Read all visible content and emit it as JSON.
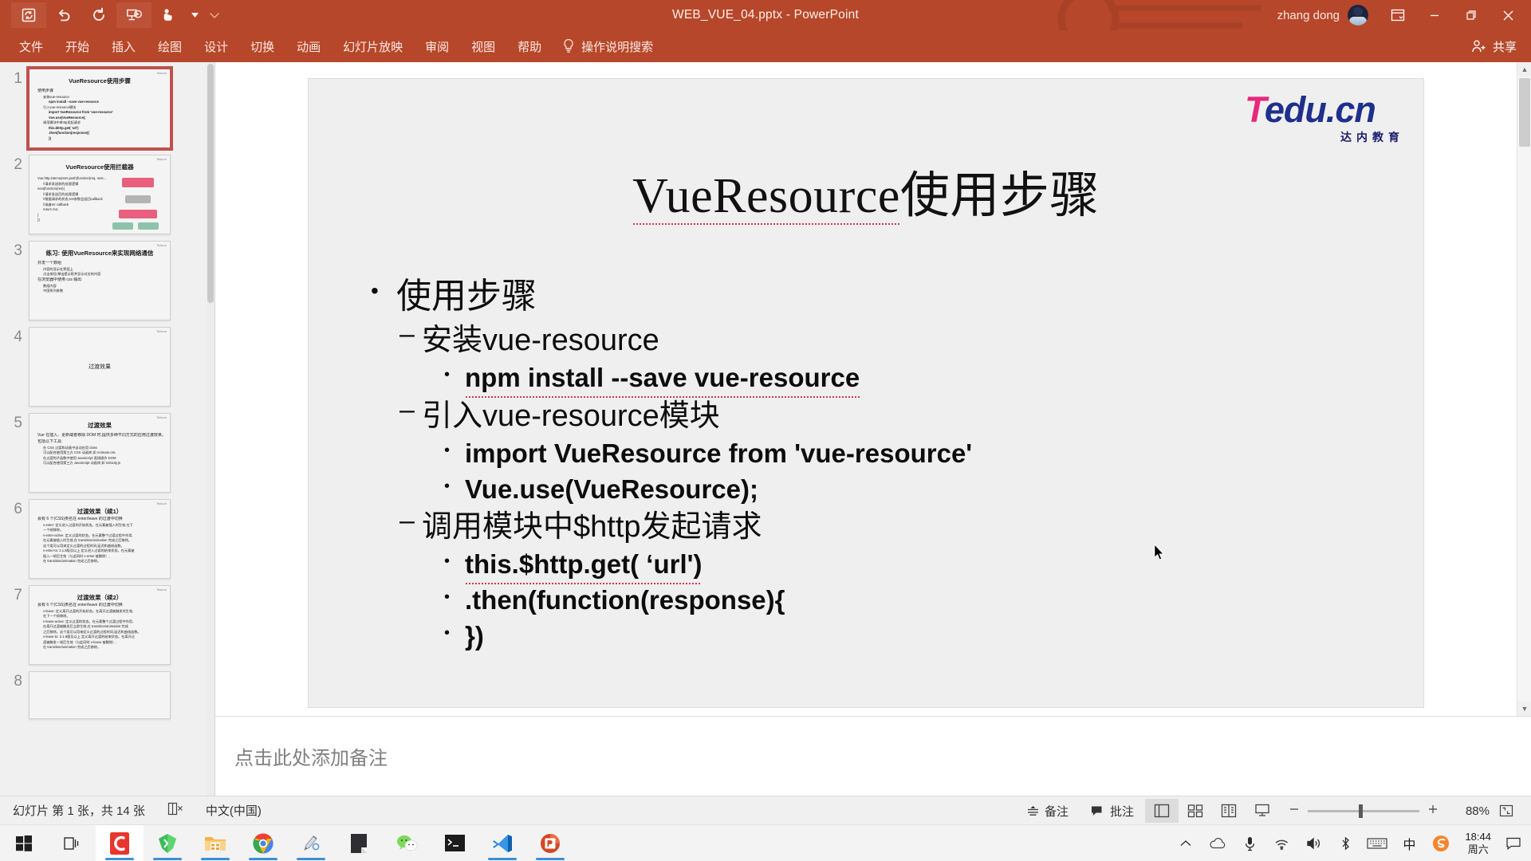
{
  "window": {
    "title": "WEB_VUE_04.pptx  -  PowerPoint",
    "account_name": "zhang dong",
    "ribbon_display_label": "ribbon-display-options",
    "minimize_label": "最小化",
    "restore_label": "还原",
    "close_label": "关闭"
  },
  "quick_access": [
    {
      "name": "autosave-icon",
      "label": "自动保存"
    },
    {
      "name": "undo-icon",
      "label": "撤消"
    },
    {
      "name": "redo-icon",
      "label": "恢复"
    },
    {
      "name": "start-from-beginning-icon",
      "label": "从头开始"
    },
    {
      "name": "touch-mode-icon",
      "label": "触摸/鼠标模式"
    },
    {
      "name": "customize-qat-icon",
      "label": "自定义快速访问工具栏"
    }
  ],
  "ribbon": {
    "tabs": [
      {
        "label": "文件",
        "active": false
      },
      {
        "label": "开始",
        "active": false
      },
      {
        "label": "插入",
        "active": false
      },
      {
        "label": "绘图",
        "active": false
      },
      {
        "label": "设计",
        "active": false
      },
      {
        "label": "切换",
        "active": false
      },
      {
        "label": "动画",
        "active": false
      },
      {
        "label": "幻灯片放映",
        "active": false
      },
      {
        "label": "审阅",
        "active": false
      },
      {
        "label": "视图",
        "active": false
      },
      {
        "label": "帮助",
        "active": false
      }
    ],
    "tell_me": "操作说明搜索",
    "share": "共享"
  },
  "thumbnails": [
    {
      "number": "1",
      "selected": true,
      "title": "VueResource使用步骤",
      "logo": "Tedu.cn",
      "lines": [
        {
          "level": 1,
          "text": "使用步骤"
        },
        {
          "level": 2,
          "text": "安装vue-resource"
        },
        {
          "level": 3,
          "text": "npm install --save vue-resource"
        },
        {
          "level": 2,
          "text": "引入vue-resource模块"
        },
        {
          "level": 3,
          "text": "import VueResource from 'vue-resource'"
        },
        {
          "level": 3,
          "text": "Vue.use(VueResource);"
        },
        {
          "level": 2,
          "text": "调用模块中$http发起请求"
        },
        {
          "level": 3,
          "text": "this.$http.get( 'url')"
        },
        {
          "level": 3,
          "text": ".then(function(response){"
        },
        {
          "level": 3,
          "text": "})"
        }
      ]
    },
    {
      "number": "2",
      "selected": false,
      "title": "VueResource使用拦截器",
      "logo": "Tedu.cn",
      "lines": [
        {
          "level": 3,
          "text": "Vue.http.interceptors.push(function(req, next..."
        },
        {
          "level": 2,
          "text": "//请求发送前的处理逻辑"
        },
        {
          "level": 3,
          "text": "next(function(res){"
        },
        {
          "level": 2,
          "text": "//请求发送后的处理逻辑"
        },
        {
          "level": 2,
          "text": "//根据请求的状态,res参数会返回callback"
        },
        {
          "level": 2,
          "text": "//或者err callback"
        },
        {
          "level": 2,
          "text": "return res;"
        },
        {
          "level": 3,
          "text": "}"
        },
        {
          "level": 3,
          "text": "})"
        }
      ]
    },
    {
      "number": "3",
      "selected": false,
      "title": "练习: 使用VueResource来实现网络通信",
      "logo": "Tedu.cn",
      "lines": [
        {
          "level": 1,
          "text": "并发一个数组"
        },
        {
          "level": 2,
          "text": "内容的显示在界面上"
        },
        {
          "level": 2,
          "text": "点击按钮,弹出提示框并显示对应的内容"
        },
        {
          "level": 1,
          "text": "在浏览器中使用 css 输出"
        },
        {
          "level": 2,
          "text": "数组内容"
        },
        {
          "level": 2,
          "text": "中国系列参数"
        }
      ]
    },
    {
      "number": "4",
      "selected": false,
      "title": "",
      "logo": "Tedu.cn",
      "center_text": "过渡效果",
      "lines": []
    },
    {
      "number": "5",
      "selected": false,
      "title": "过渡效果",
      "logo": "Tedu.cn",
      "lines": [
        {
          "level": 1,
          "text": "Vue 在插入、更新或者移除 DOM 时,提供多种不同方式的应用过渡效果。"
        },
        {
          "level": 1,
          "text": "包括以下工具:"
        },
        {
          "level": 2,
          "text": "在 CSS 过渡和动画中自动应用 class"
        },
        {
          "level": 2,
          "text": "可以配合使用第三方 CSS 动画库,如 Animate.css"
        },
        {
          "level": 2,
          "text": "在过渡钩子函数中使用 JavaScript 直接操作 DOM"
        },
        {
          "level": 2,
          "text": "可以配合使用第三方 JavaScript 动画库,如 Velocity.js"
        }
      ]
    },
    {
      "number": "6",
      "selected": false,
      "title": "过渡效果（续1）",
      "logo": "Tedu.cn",
      "lines": [
        {
          "level": 1,
          "text": "会有 6 个(CSS)类名在 enter/leave 的过渡中切换"
        },
        {
          "level": 2,
          "text": "v-enter: 定义进入过渡的开始状态。在元素被插入时生效,在下"
        },
        {
          "level": 2,
          "text": "一个帧移除。"
        },
        {
          "level": 2,
          "text": "v-enter-active: 定义过渡的状态。在元素整个过渡过程中作用,"
        },
        {
          "level": 2,
          "text": "在元素被插入时生效,在 transition/animation 完成之后移除。"
        },
        {
          "level": 2,
          "text": "这个类可以用来定义过渡的过程时间,延迟和曲线函数。"
        },
        {
          "level": 2,
          "text": "v-enter-to: 2.1.8版及以上 定义进入过渡的结束状态。在元素被"
        },
        {
          "level": 2,
          "text": "插入一帧后生效（与此同时 v-enter 被删除）,"
        },
        {
          "level": 2,
          "text": "在 transition/animation 完成之后移除。"
        }
      ]
    },
    {
      "number": "7",
      "selected": false,
      "title": "过渡效果（续2）",
      "logo": "Tedu.cn",
      "lines": [
        {
          "level": 1,
          "text": "会有 6 个(CSS)类名在 enter/leave 的过渡中切换"
        },
        {
          "level": 2,
          "text": "v-leave: 定义离开过渡的开始状态。在离开过渡被触发时生效,"
        },
        {
          "level": 2,
          "text": "在下一个帧移除。"
        },
        {
          "level": 2,
          "text": "v-leave-active: 定义过渡的状态。在元素整个过渡过程中作用,"
        },
        {
          "level": 2,
          "text": "在离开过渡被触发后立即生效,在 transition/animation 完成"
        },
        {
          "level": 2,
          "text": "之后移除。这个类可以用来定义过渡的过程时间,延迟和曲线函数。"
        },
        {
          "level": 2,
          "text": "v-leave-to: 2.1.8版及以上 定义离开过渡的结束状态。在离开过"
        },
        {
          "level": 2,
          "text": "渡被触发一帧后生效（与此同时 v-leave 被删除）,"
        },
        {
          "level": 2,
          "text": "在 transition/animation 完成之后移除。"
        }
      ]
    },
    {
      "number": "8",
      "selected": false,
      "title": "",
      "logo": "",
      "lines": []
    }
  ],
  "slide": {
    "logo_t": "T",
    "logo_rest": "edu.cn",
    "logo_sub": "达内教育",
    "title_underlined": "VueResource",
    "title_rest": "使用步骤",
    "bullets": [
      {
        "level": 1,
        "bullet": "•",
        "text": "使用步骤"
      },
      {
        "level": 2,
        "bullet": "–",
        "text": "安装vue-resource"
      },
      {
        "level": 3,
        "bullet": "•",
        "text": "npm install --save vue-resource"
      },
      {
        "level": 2,
        "bullet": "–",
        "text": "引入vue-resource模块"
      },
      {
        "level": 3,
        "bullet": "•",
        "text": "import VueResource from 'vue-resource'"
      },
      {
        "level": 3,
        "bullet": "•",
        "text": "Vue.use(VueResource);"
      },
      {
        "level": 2,
        "bullet": "–",
        "text": "调用模块中$http发起请求"
      },
      {
        "level": 3,
        "bullet": "•",
        "text": "this.$http.get(  ‘url')"
      },
      {
        "level": 3,
        "bullet": "•",
        "text": ".then(function(response){"
      },
      {
        "level": 3,
        "bullet": "•",
        "text": "})"
      }
    ]
  },
  "notes": {
    "placeholder": "点击此处添加备注"
  },
  "status": {
    "slide_info": "幻灯片 第 1 张，共 14 张",
    "accessibility_label": "辅助功能检查",
    "language": "中文(中国)",
    "notes_label": "备注",
    "comments_label": "批注",
    "views": [
      {
        "name": "normal-view-button",
        "label": "普通视图",
        "active": true
      },
      {
        "name": "slide-sorter-button",
        "label": "幻灯片浏览",
        "active": false
      },
      {
        "name": "reading-view-button",
        "label": "阅读视图",
        "active": false
      },
      {
        "name": "slideshow-button",
        "label": "幻灯片放映",
        "active": false
      }
    ],
    "zoom_out": "缩小",
    "zoom_in": "放大",
    "zoom_percent": "88%",
    "fit_label": "使幻灯片适应当前窗口"
  },
  "taskbar": {
    "items": [
      {
        "name": "start-button",
        "label": "开始",
        "running": false
      },
      {
        "name": "task-view-button",
        "label": "任务视图",
        "running": false
      },
      {
        "name": "taskbar-app-camtasia",
        "label": "Camtasia",
        "running": true,
        "focused": true
      },
      {
        "name": "taskbar-app-webstorm",
        "label": "WebStorm",
        "running": true
      },
      {
        "name": "taskbar-app-file-explorer",
        "label": "文件资源管理器",
        "running": true
      },
      {
        "name": "taskbar-app-chrome",
        "label": "Google Chrome",
        "running": true
      },
      {
        "name": "taskbar-app-snipping",
        "label": "截图工具",
        "running": true
      },
      {
        "name": "taskbar-app-notepad",
        "label": "记事本",
        "running": false
      },
      {
        "name": "taskbar-app-wechat",
        "label": "微信",
        "running": false
      },
      {
        "name": "taskbar-app-terminal",
        "label": "命令提示符",
        "running": false
      },
      {
        "name": "taskbar-app-vscode",
        "label": "Visual Studio Code",
        "running": true
      },
      {
        "name": "taskbar-app-powerpoint",
        "label": "PowerPoint",
        "running": true
      }
    ],
    "tray": [
      {
        "name": "show-hidden-icons-button",
        "label": "显示隐藏的图标"
      },
      {
        "name": "onedrive-icon",
        "label": "OneDrive"
      },
      {
        "name": "microphone-icon",
        "label": "麦克风"
      },
      {
        "name": "network-icon",
        "label": "网络"
      },
      {
        "name": "volume-icon",
        "label": "音量"
      },
      {
        "name": "bluetooth-icon",
        "label": "设备"
      },
      {
        "name": "touch-keyboard-icon",
        "label": "触摸键盘"
      },
      {
        "name": "ime-mode-icon",
        "label": "中"
      },
      {
        "name": "sogou-input-icon",
        "label": "搜狗输入法"
      }
    ],
    "clock_time": "18:44",
    "clock_date": "周六",
    "notification_label": "通知"
  },
  "colors": {
    "brand_red": "#b7472a",
    "accent_selected": "#c0504d",
    "logo_pink": "#e8277d",
    "logo_blue": "#1e2f8c",
    "spell_underline": "#d0384b"
  }
}
